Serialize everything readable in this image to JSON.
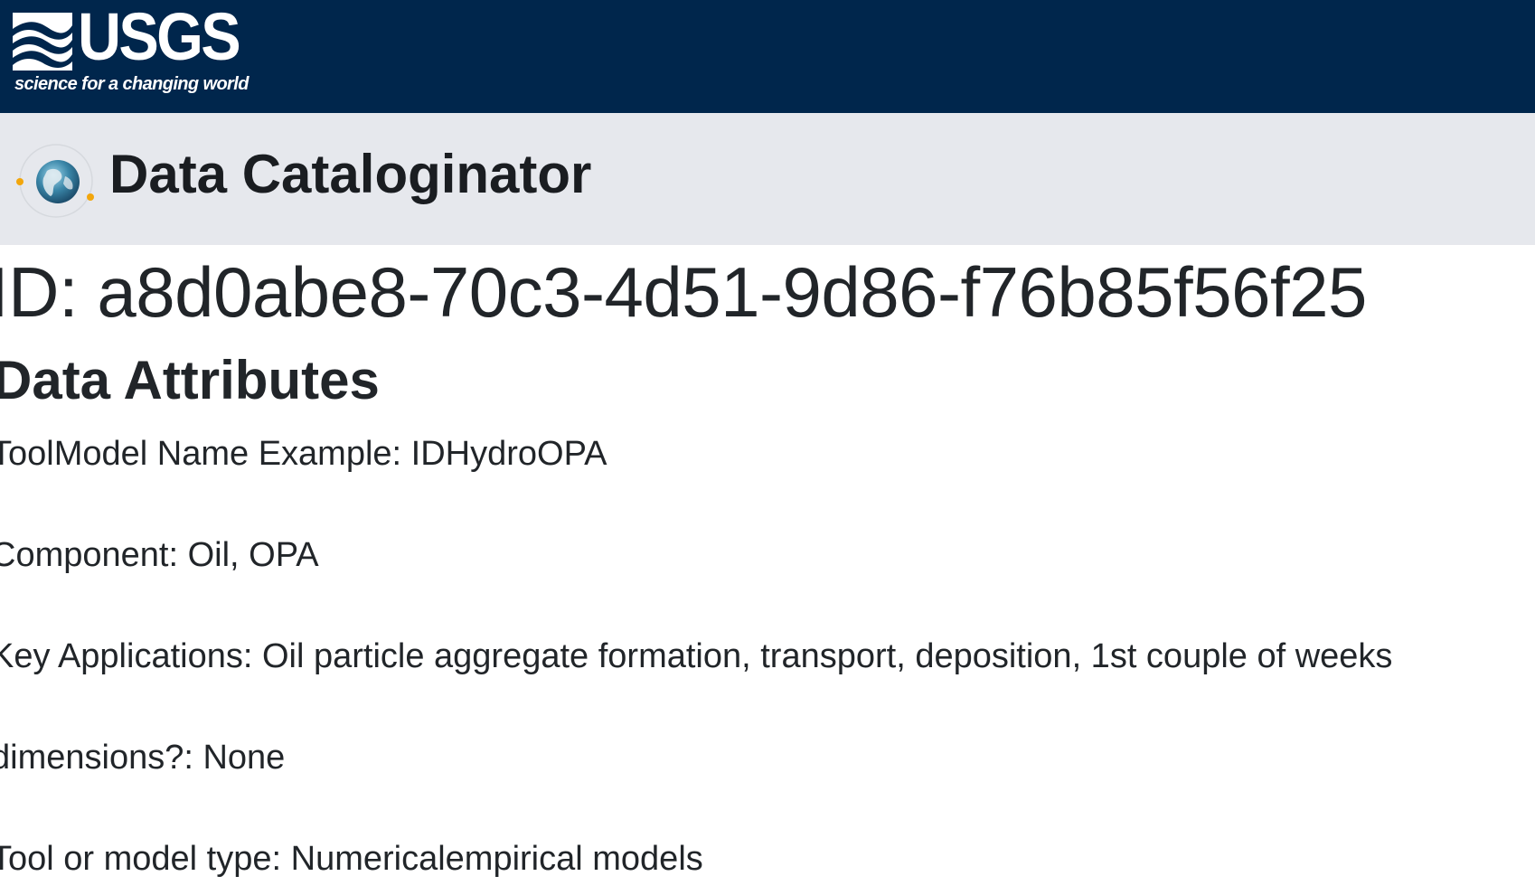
{
  "header": {
    "logo_text": "USGS",
    "logo_tagline": "science for a changing world",
    "background_color": "#00264c"
  },
  "app_bar": {
    "title": "Data Cataloginator",
    "logo_icon": "globe-icon",
    "background_color": "#e6e8ed"
  },
  "record": {
    "id_label": "ID:",
    "id_value": "a8d0abe8-70c3-4d51-9d86-f76b85f56f25",
    "section_title": "Data Attributes",
    "attributes": [
      {
        "label": "ToolModel Name Example",
        "value": "IDHydroOPA"
      },
      {
        "label": "Component",
        "value": "Oil, OPA"
      },
      {
        "label": "Key Applications",
        "value": "Oil particle aggregate formation, transport, deposition, 1st couple of weeks"
      },
      {
        "label": "dimensions?",
        "value": "None"
      },
      {
        "label": "Tool or model type",
        "value": "Numericalempirical models"
      }
    ]
  }
}
